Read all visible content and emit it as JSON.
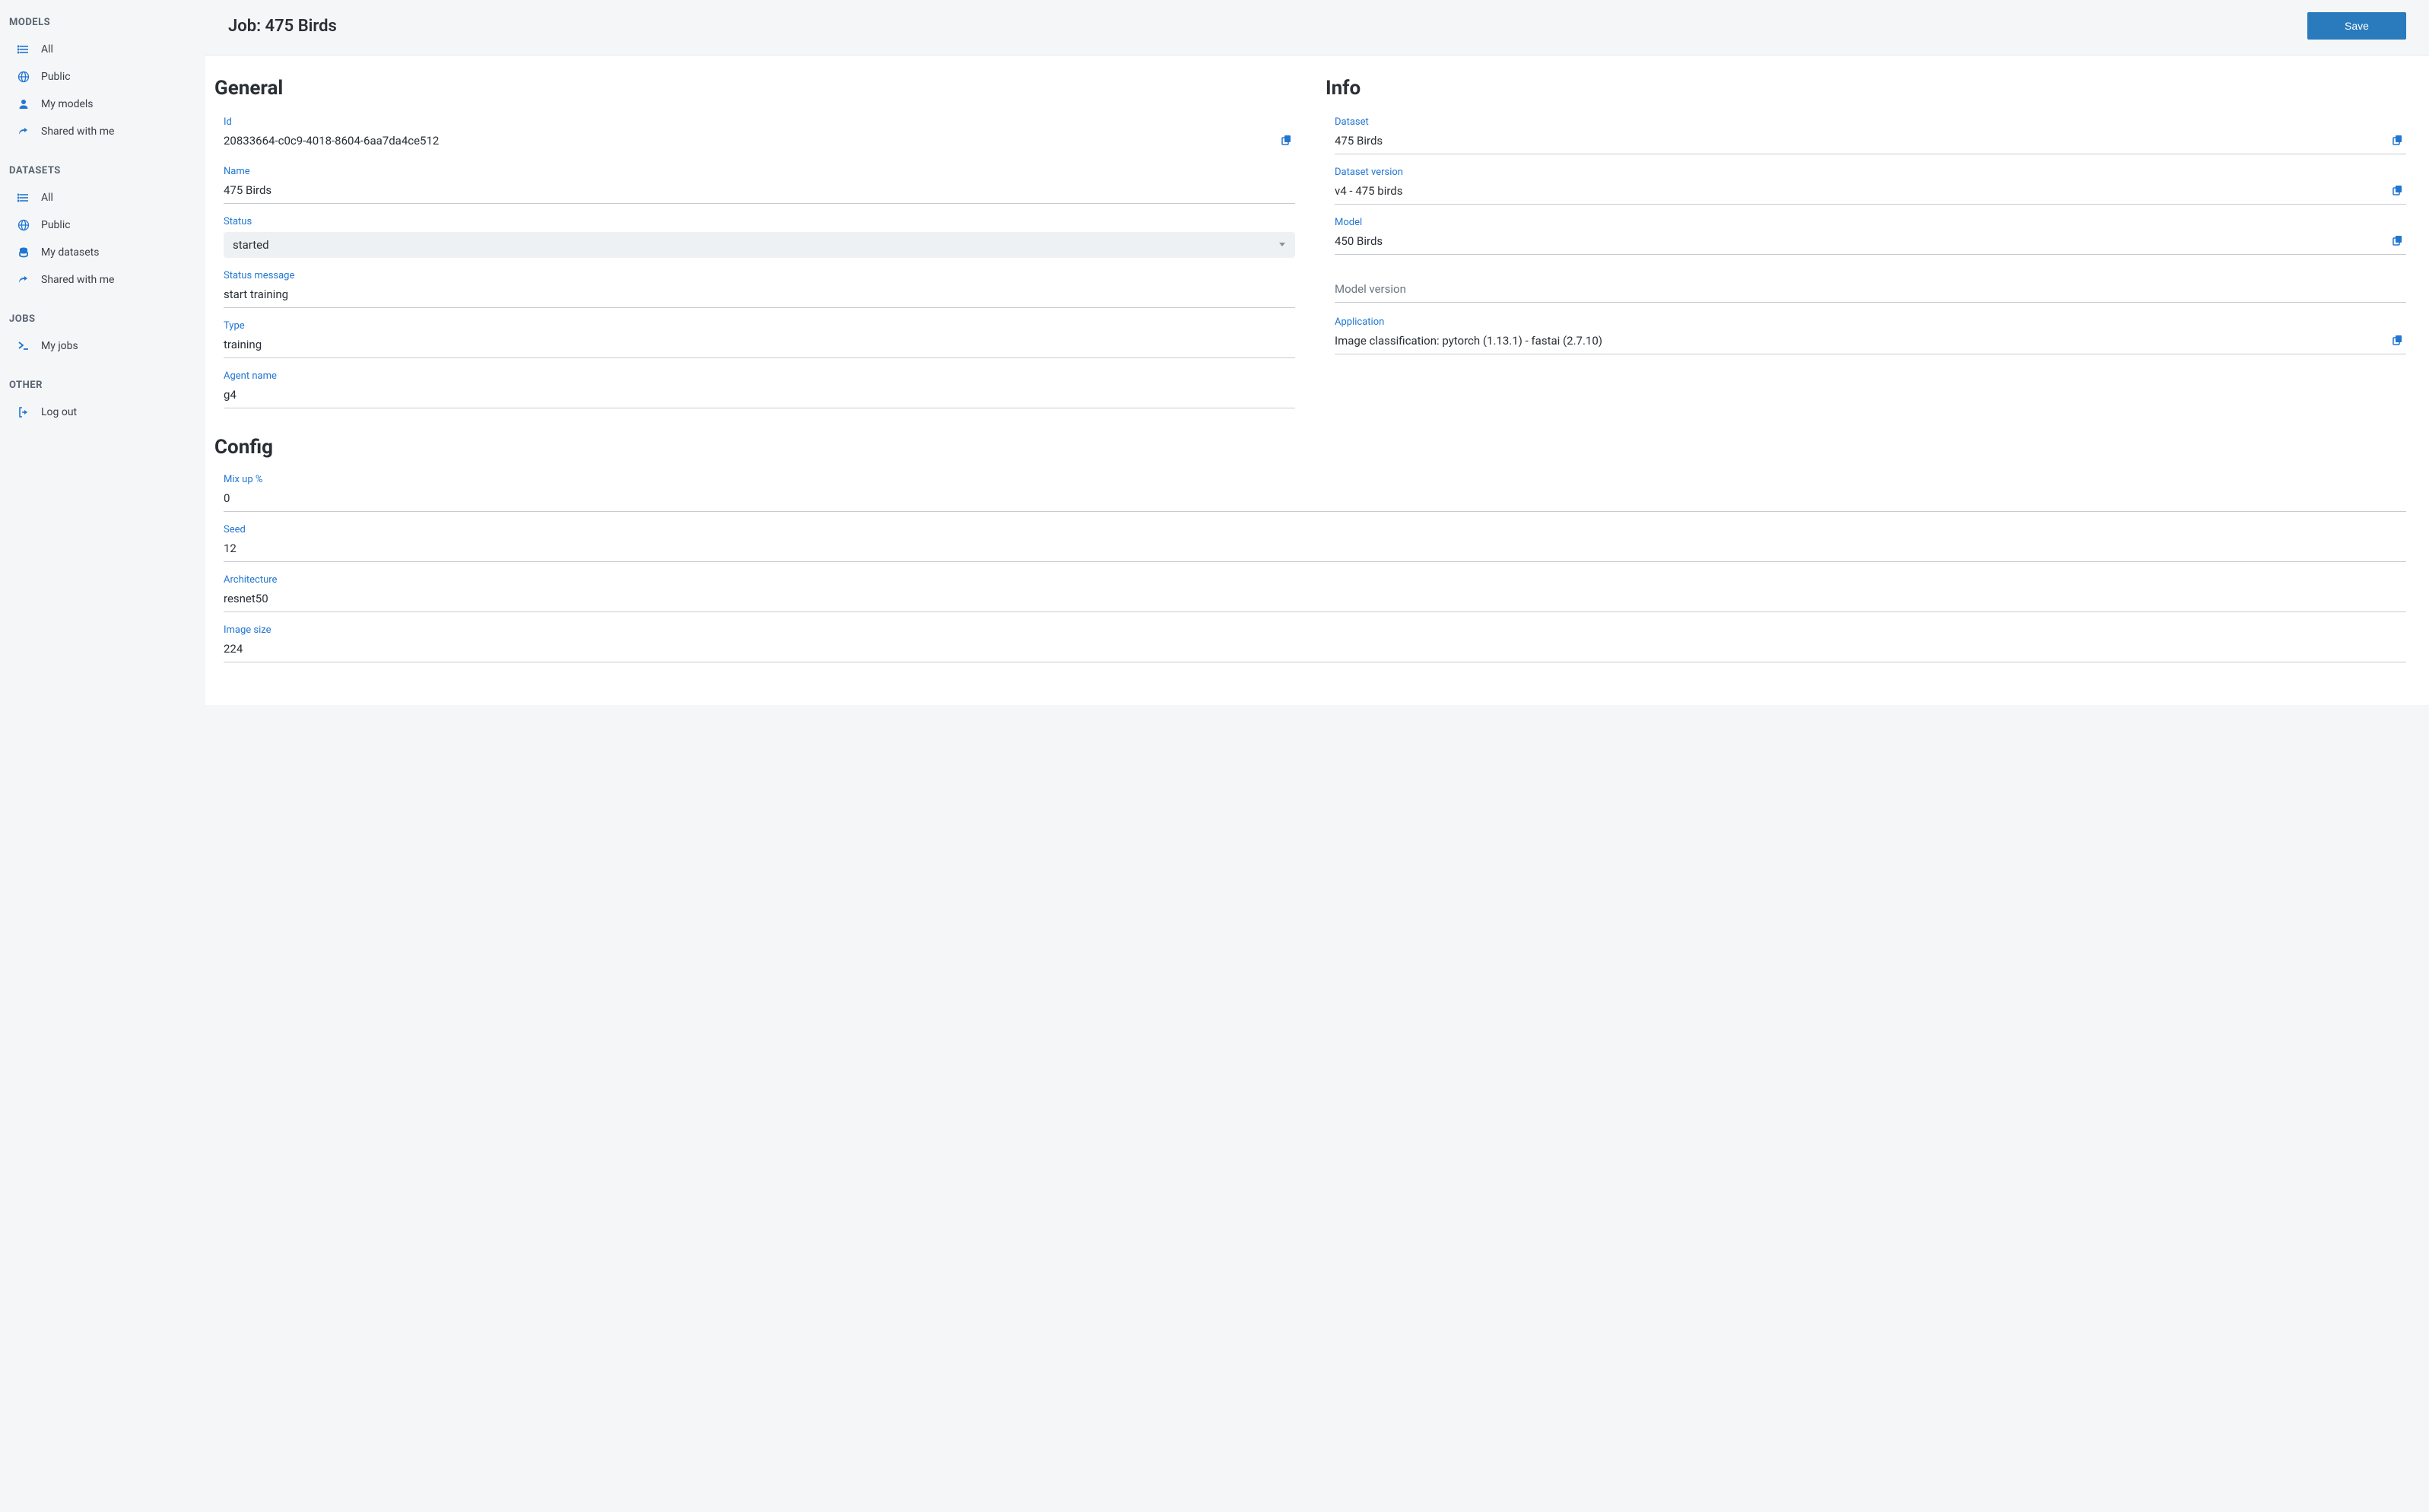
{
  "sidebar": {
    "models": {
      "heading": "MODELS",
      "items": [
        {
          "label": "All"
        },
        {
          "label": "Public"
        },
        {
          "label": "My models"
        },
        {
          "label": "Shared with me"
        }
      ]
    },
    "datasets": {
      "heading": "DATASETS",
      "items": [
        {
          "label": "All"
        },
        {
          "label": "Public"
        },
        {
          "label": "My datasets"
        },
        {
          "label": "Shared with me"
        }
      ]
    },
    "jobs": {
      "heading": "JOBS",
      "items": [
        {
          "label": "My jobs"
        }
      ]
    },
    "other": {
      "heading": "OTHER",
      "items": [
        {
          "label": "Log out"
        }
      ]
    }
  },
  "header": {
    "title": "Job: 475 Birds",
    "save_label": "Save"
  },
  "general": {
    "title": "General",
    "id_label": "Id",
    "id_value": "20833664-c0c9-4018-8604-6aa7da4ce512",
    "name_label": "Name",
    "name_value": "475 Birds",
    "status_label": "Status",
    "status_value": "started",
    "status_message_label": "Status message",
    "status_message_value": "start training",
    "type_label": "Type",
    "type_value": "training",
    "agent_name_label": "Agent name",
    "agent_name_value": "g4"
  },
  "info": {
    "title": "Info",
    "dataset_label": "Dataset",
    "dataset_value": "475 Birds",
    "dataset_version_label": "Dataset version",
    "dataset_version_value": "v4 - 475 birds",
    "model_label": "Model",
    "model_value": "450 Birds",
    "model_version_label": "Model version",
    "application_label": "Application",
    "application_value": "Image classification: pytorch (1.13.1) - fastai (2.7.10)"
  },
  "config": {
    "title": "Config",
    "mixup_label": "Mix up %",
    "mixup_value": "0",
    "seed_label": "Seed",
    "seed_value": "12",
    "architecture_label": "Architecture",
    "architecture_value": "resnet50",
    "image_size_label": "Image size",
    "image_size_value": "224"
  }
}
